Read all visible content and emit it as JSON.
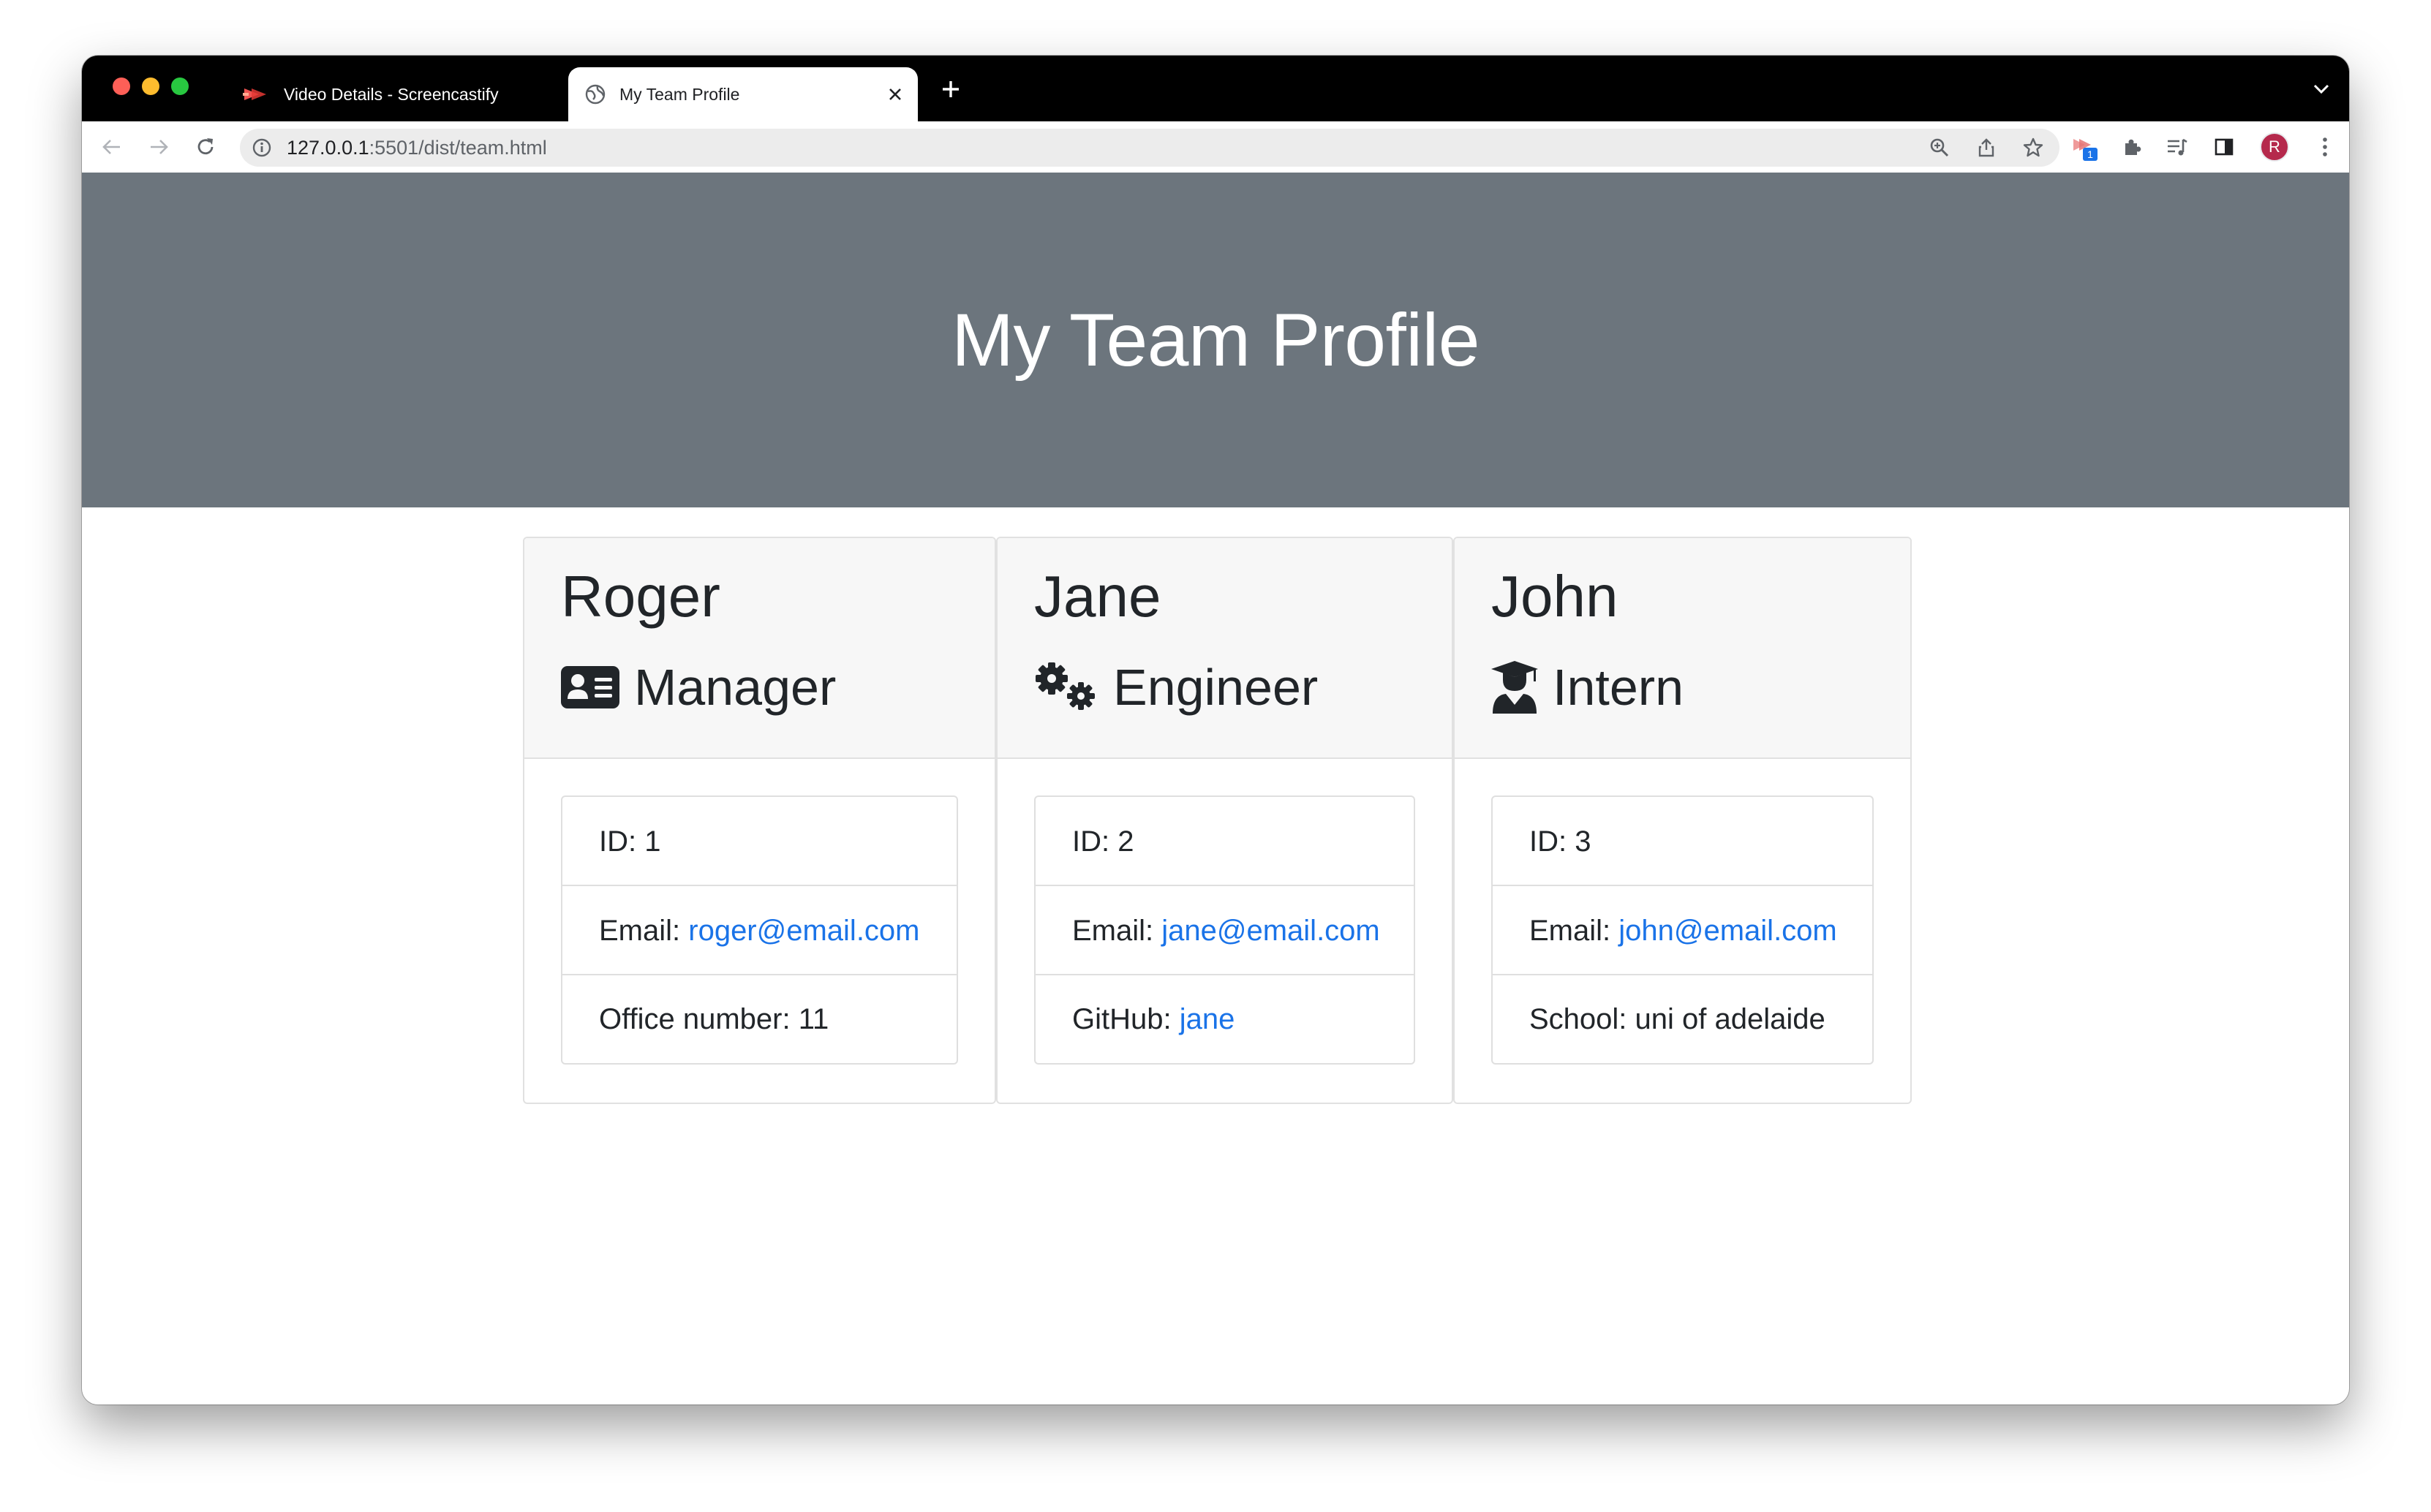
{
  "browser": {
    "tabs": [
      {
        "title": "Video Details - Screencastify",
        "active": false,
        "icon": "screencastify-icon"
      },
      {
        "title": "My Team Profile",
        "active": true,
        "icon": "globe-icon"
      }
    ],
    "url_host": "127.0.0.1",
    "url_path": ":5501/dist/team.html",
    "profile_initial": "R",
    "extension_badge": "1"
  },
  "page": {
    "title": "My Team Profile",
    "team": [
      {
        "name": "Roger",
        "role": "Manager",
        "role_icon": "id-card-icon",
        "id_label": "ID: 1",
        "email_label": "Email: ",
        "email": "roger@email.com",
        "extra_label": "Office number: 11",
        "extra_link": ""
      },
      {
        "name": "Jane",
        "role": "Engineer",
        "role_icon": "cogs-icon",
        "id_label": "ID: 2",
        "email_label": "Email: ",
        "email": "jane@email.com",
        "extra_label": "GitHub: ",
        "extra_link": "jane"
      },
      {
        "name": "John",
        "role": "Intern",
        "role_icon": "graduate-icon",
        "id_label": "ID: 3",
        "email_label": "Email: ",
        "email": "john@email.com",
        "extra_label": "School: uni of adelaide",
        "extra_link": ""
      }
    ]
  },
  "colors": {
    "hero_bg": "#6c757d",
    "link": "#1a73e8",
    "card_header_bg": "#f7f7f7"
  }
}
